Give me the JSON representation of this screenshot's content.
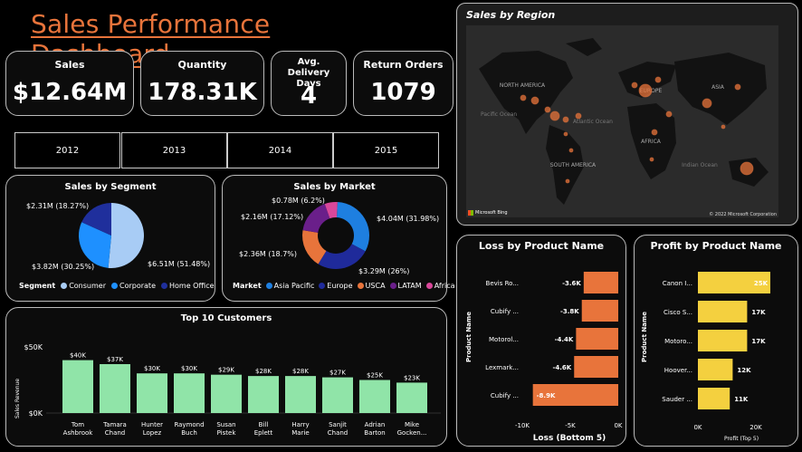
{
  "header": {
    "title": "Sales Performance Dashboard"
  },
  "kpis": {
    "sales": {
      "label": "Sales",
      "value": "$12.64M"
    },
    "quantity": {
      "label": "Quantity",
      "value": "178.31K"
    },
    "delivery": {
      "label": "Avg. Delivery Days",
      "value": "4"
    },
    "returns": {
      "label": "Return Orders",
      "value": "1079"
    }
  },
  "years": [
    "2012",
    "2013",
    "2014",
    "2015"
  ],
  "colors": {
    "accent": "#e8743b",
    "profit": "#f4d03f",
    "bars": "#90e4a8",
    "segment": [
      "#a8ccf5",
      "#1e90ff",
      "#1f2f9c"
    ],
    "market": [
      "#1e7fe0",
      "#1f2a9a",
      "#e8743b",
      "#6a1f8a",
      "#d9479a"
    ]
  },
  "segment_chart": {
    "title": "Sales by Segment",
    "legend_title": "Segment",
    "labels": [
      "$6.51M (51.48%)",
      "$3.82M (30.25%)",
      "$2.31M (18.27%)"
    ]
  },
  "market_chart": {
    "title": "Sales by Market",
    "legend_title": "Market",
    "labels": [
      "$4.04M (31.98%)",
      "$3.29M (26%)",
      "$2.36M (18.7%)",
      "$2.16M (17.12%)",
      "$0.78M (6.2%)"
    ]
  },
  "customers_chart": {
    "title": "Top 10 Customers",
    "ylabel": "Sales Revenue",
    "yticks": [
      "$50K",
      "$0K"
    ]
  },
  "map": {
    "title": "Sales by Region",
    "labels": [
      "NORTH AMERICA",
      "EUROPE",
      "ASIA",
      "AFRICA",
      "SOUTH AMERICA",
      "Atlantic Ocean",
      "Pacific Ocean",
      "Indian Ocean"
    ],
    "brand": "Microsoft Bing",
    "copyright": "© 2022 Microsoft Corporation"
  },
  "loss_chart": {
    "title": "Loss by Product Name",
    "ylabel": "Product Name",
    "xlabel": "Loss (Bottom 5)",
    "xticks": [
      "-10K",
      "-5K",
      "0K"
    ]
  },
  "profit_chart": {
    "title": "Profit by Product Name",
    "ylabel": "Product Name",
    "xlabel": "Profit (Top 5)",
    "xticks": [
      "0K",
      "20K"
    ]
  },
  "chart_data": [
    {
      "type": "pie",
      "title": "Sales by Segment",
      "categories": [
        "Consumer",
        "Corporate",
        "Home Office"
      ],
      "values": [
        6.51,
        3.82,
        2.31
      ],
      "percent": [
        51.48,
        30.25,
        18.27
      ],
      "unit": "$M",
      "legend": "bottom"
    },
    {
      "type": "pie",
      "title": "Sales by Market",
      "donut": true,
      "categories": [
        "Asia Pacific",
        "Europe",
        "USCA",
        "LATAM",
        "Africa"
      ],
      "values": [
        4.04,
        3.29,
        2.36,
        2.16,
        0.78
      ],
      "percent": [
        31.98,
        26,
        18.7,
        17.12,
        6.2
      ],
      "unit": "$M",
      "legend": "bottom"
    },
    {
      "type": "bar",
      "title": "Top 10 Customers",
      "categories": [
        "Tom Ashbrook",
        "Tamara Chand",
        "Hunter Lopez",
        "Raymond Buch",
        "Susan Pistek",
        "Bill Eplett",
        "Harry Marie",
        "Sanjit Chand",
        "Adrian Barton",
        "Mike Gocken..."
      ],
      "values": [
        40,
        37,
        30,
        30,
        29,
        28,
        28,
        27,
        25,
        23
      ],
      "data_labels": [
        "$40K",
        "$37K",
        "$30K",
        "$30K",
        "$29K",
        "$28K",
        "$28K",
        "$27K",
        "$25K",
        "$23K"
      ],
      "ylabel": "Sales Revenue",
      "unit": "$K",
      "ylim": [
        0,
        50
      ]
    },
    {
      "type": "bar",
      "orientation": "horizontal",
      "title": "Loss by Product Name",
      "categories": [
        "Bevis Ro...",
        "Cubify ...",
        "Motorol...",
        "Lexmark...",
        "Cubify ..."
      ],
      "values": [
        -3.6,
        -3.8,
        -4.4,
        -4.6,
        -8.9
      ],
      "data_labels": [
        "-3.6K",
        "-3.8K",
        "-4.4K",
        "-4.6K",
        "-8.9K"
      ],
      "xlabel": "Loss (Bottom 5)",
      "ylabel": "Product Name",
      "unit": "K",
      "xlim": [
        -10,
        0
      ]
    },
    {
      "type": "bar",
      "orientation": "horizontal",
      "title": "Profit by Product Name",
      "categories": [
        "Canon I...",
        "Cisco S...",
        "Motoro...",
        "Hoover...",
        "Sauder ..."
      ],
      "values": [
        25,
        17,
        17,
        12,
        11
      ],
      "data_labels": [
        "25K",
        "17K",
        "17K",
        "12K",
        "11K"
      ],
      "xlabel": "Profit (Top 5)",
      "ylabel": "Product Name",
      "unit": "K",
      "xlim": [
        0,
        25
      ]
    }
  ]
}
